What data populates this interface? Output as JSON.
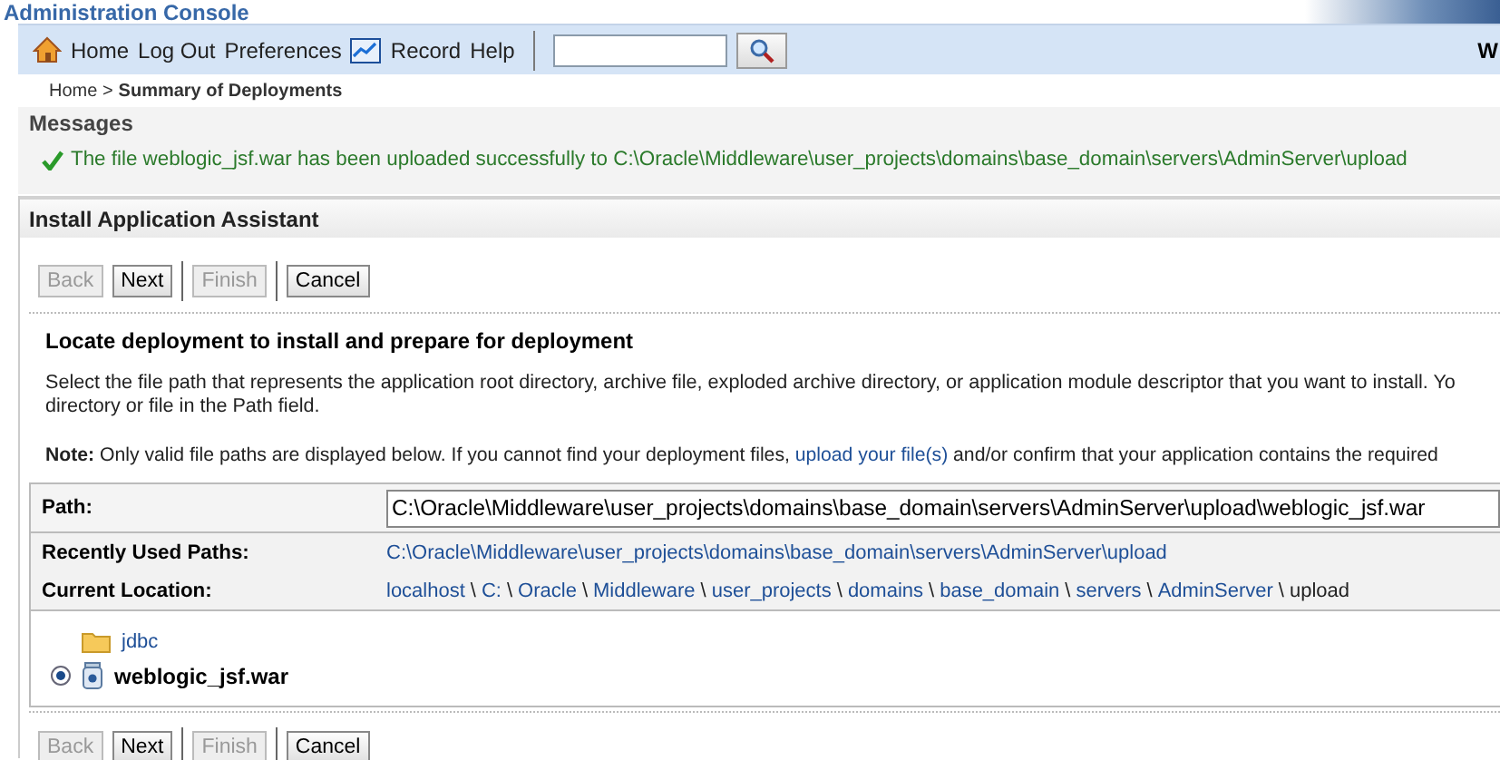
{
  "header": {
    "title": "Administration Console"
  },
  "toolbar": {
    "links": [
      {
        "label": "Home"
      },
      {
        "label": "Log Out"
      },
      {
        "label": "Preferences"
      },
      {
        "label": "Record"
      },
      {
        "label": "Help"
      }
    ],
    "welcome": "W"
  },
  "breadcrumb": {
    "link": "Home >",
    "current": "Summary of Deployments"
  },
  "messages": {
    "title": "Messages",
    "items": [
      {
        "kind": "success",
        "text": "The file weblogic_jsf.war has been uploaded successfully to C:\\Oracle\\Middleware\\user_projects\\domains\\base_domain\\servers\\AdminServer\\upload"
      }
    ]
  },
  "assistant": {
    "title": "Install Application Assistant",
    "top_buttons": [
      {
        "label": "Back",
        "disabled": true,
        "divider_before": false
      },
      {
        "label": "Next",
        "disabled": false,
        "divider_before": false
      },
      {
        "label": "Finish",
        "disabled": true,
        "divider_before": true
      },
      {
        "label": "Cancel",
        "disabled": false,
        "divider_before": true
      }
    ],
    "heading": "Locate deployment to install and prepare for deployment",
    "description": "Select the file path that represents the application root directory, archive file, exploded archive directory, or application module descriptor that you want to install. Yo\ndirectory or file in the Path field.",
    "note": {
      "text": "**Note:** Only valid file paths are displayed below. If you cannot find your deployment files, ",
      "link": "upload your file(s)",
      "after": " and/or confirm that your application contains the required"
    },
    "path": {
      "label": "Path:",
      "value": "C:\\Oracle\\Middleware\\user_projects\\domains\\base_domain\\servers\\AdminServer\\upload\\weblogic_jsf.war"
    },
    "recent": {
      "label": "Recently Used Paths:",
      "link": "C:\\Oracle\\Middleware\\user_projects\\domains\\base_domain\\servers\\AdminServer\\upload"
    },
    "location": {
      "label": "Current Location:",
      "separator": "\\",
      "segments": [
        {
          "text": "localhost",
          "current": false
        },
        {
          "text": "C:",
          "current": false
        },
        {
          "text": "Oracle",
          "current": false
        },
        {
          "text": "Middleware",
          "current": false
        },
        {
          "text": "user_projects",
          "current": false
        },
        {
          "text": "domains",
          "current": false
        },
        {
          "text": "base_domain",
          "current": false
        },
        {
          "text": "servers",
          "current": false
        },
        {
          "text": "AdminServer",
          "current": false
        },
        {
          "text": "upload",
          "current": true
        }
      ]
    },
    "files": [
      {
        "kind": "folder",
        "name": "jdbc",
        "selected": false
      },
      {
        "kind": "archive",
        "name": "weblogic_jsf.war",
        "selected": true
      }
    ],
    "bottom_buttons": [
      {
        "label": "Back",
        "disabled": true,
        "divider_before": false
      },
      {
        "label": "Next",
        "disabled": false,
        "divider_before": false
      },
      {
        "label": "Finish",
        "disabled": true,
        "divider_before": true
      },
      {
        "label": "Cancel",
        "disabled": false,
        "divider_before": true
      }
    ]
  }
}
